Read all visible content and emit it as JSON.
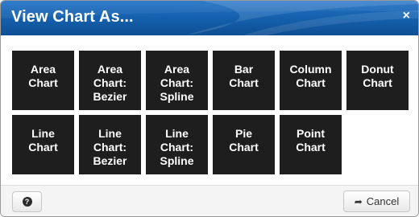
{
  "dialog": {
    "title": "View Chart As...",
    "close_glyph": "×"
  },
  "tiles": [
    {
      "lines": [
        "Area",
        "Chart"
      ]
    },
    {
      "lines": [
        "Area",
        "Chart:",
        "Bezier"
      ]
    },
    {
      "lines": [
        "Area",
        "Chart:",
        "Spline"
      ]
    },
    {
      "lines": [
        "Bar",
        "Chart"
      ]
    },
    {
      "lines": [
        "Column",
        "Chart"
      ]
    },
    {
      "lines": [
        "Donut",
        "Chart"
      ]
    },
    {
      "lines": [
        "Line",
        "Chart"
      ]
    },
    {
      "lines": [
        "Line",
        "Chart:",
        "Bezier"
      ]
    },
    {
      "lines": [
        "Line",
        "Chart:",
        "Spline"
      ]
    },
    {
      "lines": [
        "Pie",
        "Chart"
      ]
    },
    {
      "lines": [
        "Point",
        "Chart"
      ]
    }
  ],
  "footer": {
    "help_glyph": "?",
    "cancel_icon": "share-arrow-icon",
    "cancel_glyph": "➦",
    "cancel_label": "Cancel"
  },
  "colors": {
    "titlebar": "#1560ad",
    "tile_bg": "#1e1e1e",
    "tile_text": "#ffffff"
  }
}
